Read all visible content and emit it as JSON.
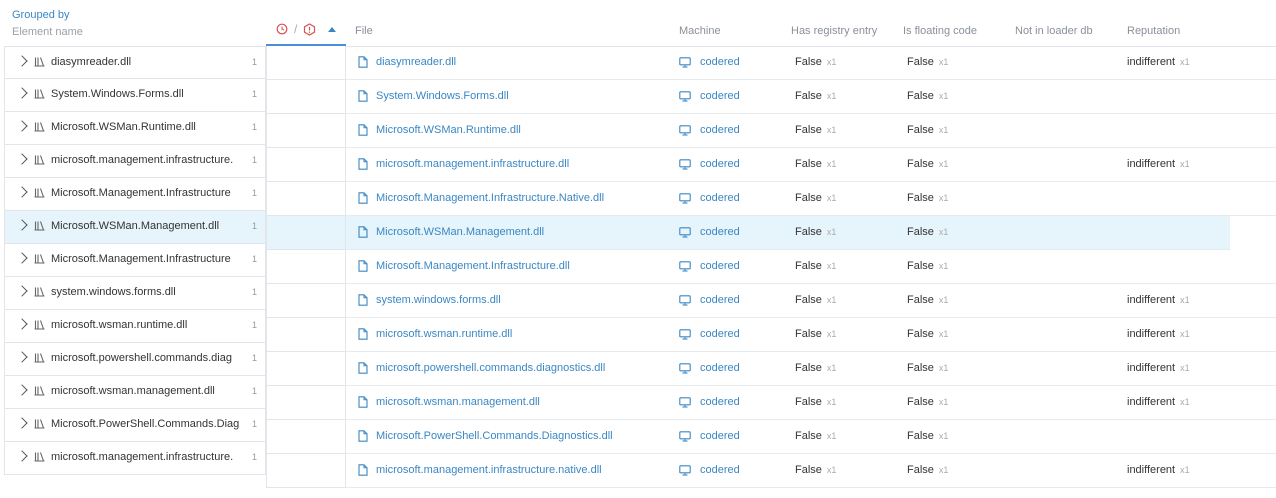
{
  "grouped_by": {
    "title": "Grouped by",
    "field": "Element name"
  },
  "columns": {
    "file": "File",
    "machine": "Machine",
    "has_registry_entry": "Has registry entry",
    "is_floating_code": "Is floating code",
    "not_in_loader_db": "Not in loader db",
    "reputation": "Reputation"
  },
  "header_icons": [
    "clock-alert-icon",
    "hexagon-alert-icon"
  ],
  "colors": {
    "accent": "#3a87c4",
    "selected_row": "#e6f4fb",
    "alert": "#d9534f"
  },
  "groups": [
    {
      "name": "diasymreader.dll",
      "count": "1"
    },
    {
      "name": "System.Windows.Forms.dll",
      "count": "1"
    },
    {
      "name": "Microsoft.WSMan.Runtime.dll",
      "count": "1"
    },
    {
      "name": "microsoft.management.infrastructure.",
      "count": "1"
    },
    {
      "name": "Microsoft.Management.Infrastructure",
      "count": "1"
    },
    {
      "name": "Microsoft.WSMan.Management.dll",
      "count": "1"
    },
    {
      "name": "Microsoft.Management.Infrastructure",
      "count": "1"
    },
    {
      "name": "system.windows.forms.dll",
      "count": "1"
    },
    {
      "name": "microsoft.wsman.runtime.dll",
      "count": "1"
    },
    {
      "name": "microsoft.powershell.commands.diag",
      "count": "1"
    },
    {
      "name": "microsoft.wsman.management.dll",
      "count": "1"
    },
    {
      "name": "Microsoft.PowerShell.Commands.Diag",
      "count": "1"
    },
    {
      "name": "microsoft.management.infrastructure.",
      "count": "1"
    }
  ],
  "rows": [
    {
      "file": "diasymreader.dll",
      "machine": "codered",
      "registry": "False",
      "registry_count": "x1",
      "floating": "False",
      "floating_count": "x1",
      "reputation": "indifferent",
      "reputation_count": "x1"
    },
    {
      "file": "System.Windows.Forms.dll",
      "machine": "codered",
      "registry": "False",
      "registry_count": "x1",
      "floating": "False",
      "floating_count": "x1",
      "reputation": "",
      "reputation_count": ""
    },
    {
      "file": "Microsoft.WSMan.Runtime.dll",
      "machine": "codered",
      "registry": "False",
      "registry_count": "x1",
      "floating": "False",
      "floating_count": "x1",
      "reputation": "",
      "reputation_count": ""
    },
    {
      "file": "microsoft.management.infrastructure.dll",
      "machine": "codered",
      "registry": "False",
      "registry_count": "x1",
      "floating": "False",
      "floating_count": "x1",
      "reputation": "indifferent",
      "reputation_count": "x1"
    },
    {
      "file": "Microsoft.Management.Infrastructure.Native.dll",
      "machine": "codered",
      "registry": "False",
      "registry_count": "x1",
      "floating": "False",
      "floating_count": "x1",
      "reputation": "",
      "reputation_count": ""
    },
    {
      "file": "Microsoft.WSMan.Management.dll",
      "machine": "codered",
      "registry": "False",
      "registry_count": "x1",
      "floating": "False",
      "floating_count": "x1",
      "reputation": "",
      "reputation_count": ""
    },
    {
      "file": "Microsoft.Management.Infrastructure.dll",
      "machine": "codered",
      "registry": "False",
      "registry_count": "x1",
      "floating": "False",
      "floating_count": "x1",
      "reputation": "",
      "reputation_count": ""
    },
    {
      "file": "system.windows.forms.dll",
      "machine": "codered",
      "registry": "False",
      "registry_count": "x1",
      "floating": "False",
      "floating_count": "x1",
      "reputation": "indifferent",
      "reputation_count": "x1"
    },
    {
      "file": "microsoft.wsman.runtime.dll",
      "machine": "codered",
      "registry": "False",
      "registry_count": "x1",
      "floating": "False",
      "floating_count": "x1",
      "reputation": "indifferent",
      "reputation_count": "x1"
    },
    {
      "file": "microsoft.powershell.commands.diagnostics.dll",
      "machine": "codered",
      "registry": "False",
      "registry_count": "x1",
      "floating": "False",
      "floating_count": "x1",
      "reputation": "indifferent",
      "reputation_count": "x1"
    },
    {
      "file": "microsoft.wsman.management.dll",
      "machine": "codered",
      "registry": "False",
      "registry_count": "x1",
      "floating": "False",
      "floating_count": "x1",
      "reputation": "indifferent",
      "reputation_count": "x1"
    },
    {
      "file": "Microsoft.PowerShell.Commands.Diagnostics.dll",
      "machine": "codered",
      "registry": "False",
      "registry_count": "x1",
      "floating": "False",
      "floating_count": "x1",
      "reputation": "",
      "reputation_count": ""
    },
    {
      "file": "microsoft.management.infrastructure.native.dll",
      "machine": "codered",
      "registry": "False",
      "registry_count": "x1",
      "floating": "False",
      "floating_count": "x1",
      "reputation": "indifferent",
      "reputation_count": "x1"
    }
  ],
  "selected_index": 5
}
